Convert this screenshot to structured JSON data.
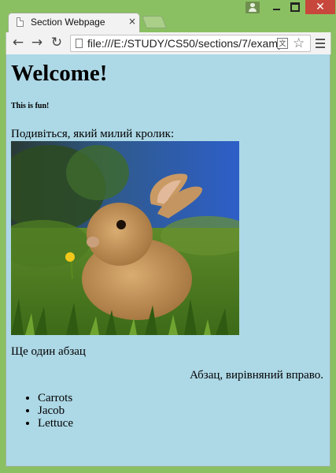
{
  "browser": {
    "tab_title": "Section Webpage",
    "tab_close": "×",
    "url": "file:///E:/STUDY/CS50/sections/7/examp",
    "window_controls": {
      "close": "✕"
    }
  },
  "page": {
    "heading": "Welcome!",
    "subheading": "This is fun!",
    "intro": "Подивіться, який милий кролик:",
    "paragraph": "Ще один абзац",
    "right_paragraph": "Абзац, вирівняний вправо.",
    "list": [
      "Carrots",
      "Jacob",
      "Lettuce"
    ]
  },
  "colors": {
    "page_background": "#add8e6",
    "window_frame": "#8bc062",
    "close_button": "#c7473c"
  },
  "icons": [
    "user-icon",
    "minimize-icon",
    "maximize-icon",
    "close-icon",
    "page-icon",
    "back-arrow-icon",
    "forward-arrow-icon",
    "reload-icon",
    "translate-icon",
    "star-icon",
    "menu-icon"
  ]
}
